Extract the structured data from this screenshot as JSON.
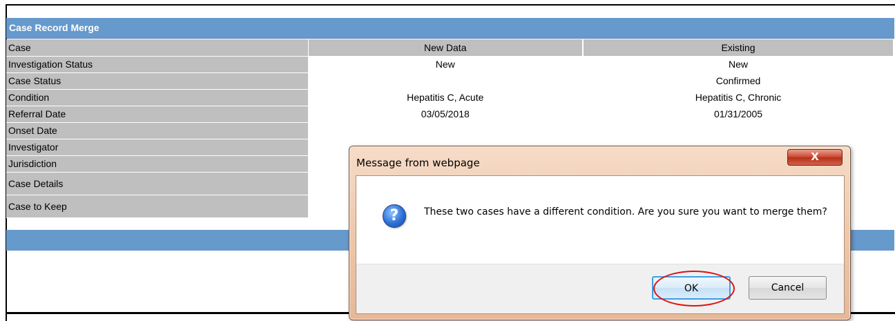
{
  "panel": {
    "title": "Case Record Merge",
    "columns": {
      "label": "Case",
      "new": "New Data",
      "existing": "Existing"
    },
    "rows": [
      {
        "label": "Investigation Status",
        "new": "New",
        "existing": "New"
      },
      {
        "label": "Case Status",
        "new": "",
        "existing": "Confirmed"
      },
      {
        "label": "Condition",
        "new": "Hepatitis C, Acute",
        "existing": "Hepatitis C, Chronic"
      },
      {
        "label": "Referral Date",
        "new": "03/05/2018",
        "existing": "01/31/2005"
      },
      {
        "label": "Onset Date",
        "new": "",
        "existing": ""
      },
      {
        "label": "Investigator",
        "new": "",
        "existing": ""
      },
      {
        "label": "Jurisdiction",
        "new": "",
        "existing": ""
      },
      {
        "label": "Case Details",
        "new": "",
        "existing": ""
      },
      {
        "label": "Case to Keep",
        "new": "",
        "existing": ""
      }
    ]
  },
  "dialog": {
    "title": "Message from webpage",
    "close_label": "X",
    "icon": "question-icon",
    "message": "These two cases have a different condition. Are you sure you want to merge them?",
    "ok_label": "OK",
    "cancel_label": "Cancel"
  },
  "colors": {
    "header_blue": "#6699cc",
    "label_gray": "#bfbfbf",
    "highlight_red": "#dd1111"
  }
}
